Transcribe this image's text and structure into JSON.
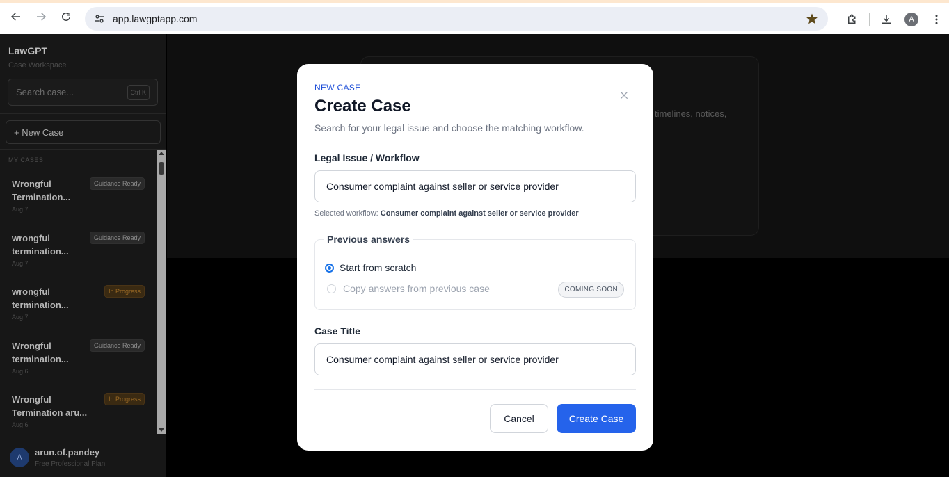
{
  "browser": {
    "url": "app.lawgptapp.com",
    "profile_initial": "A"
  },
  "sidebar": {
    "brand": "LawGPT",
    "subtitle": "Case Workspace",
    "search_placeholder": "Search case...",
    "search_shortcut": "Ctrl K",
    "new_case_label": "+ New Case",
    "section_label": "MY CASES",
    "cases": [
      {
        "title_line1": "Wrongful",
        "title_line2": "Termination...",
        "date": "Aug 7",
        "status": "Guidance Ready",
        "status_kind": "ready"
      },
      {
        "title_line1": "wrongful",
        "title_line2": "termination...",
        "date": "Aug 7",
        "status": "Guidance Ready",
        "status_kind": "ready"
      },
      {
        "title_line1": "wrongful",
        "title_line2": "termination...",
        "date": "Aug 7",
        "status": "In Progress",
        "status_kind": "progress"
      },
      {
        "title_line1": "Wrongful",
        "title_line2": "termination...",
        "date": "Aug 6",
        "status": "Guidance Ready",
        "status_kind": "ready"
      },
      {
        "title_line1": "Wrongful",
        "title_line2": "Termination aru...",
        "date": "Aug 6",
        "status": "In Progress",
        "status_kind": "progress"
      }
    ],
    "user": {
      "initial": "A",
      "name": "arun.of.pandey",
      "plan": "Free Professional Plan"
    }
  },
  "background": {
    "partial_text": "timelines, notices,"
  },
  "modal": {
    "kicker": "NEW CASE",
    "title": "Create Case",
    "subtitle": "Search for your legal issue and choose the matching workflow.",
    "workflow_label": "Legal Issue / Workflow",
    "workflow_value": "Consumer complaint against seller or service provider",
    "selected_prefix": "Selected workflow:",
    "selected_value": "Consumer complaint against seller or service provider",
    "previous_answers_legend": "Previous answers",
    "option_scratch": "Start from scratch",
    "option_copy": "Copy answers from previous case",
    "coming_soon": "COMING SOON",
    "case_title_label": "Case Title",
    "case_title_value": "Consumer complaint against seller or service provider",
    "cancel_label": "Cancel",
    "create_label": "Create Case"
  },
  "colors": {
    "accent": "#2563eb",
    "kicker": "#1d4ed8",
    "progress_badge": "#9b6a25"
  }
}
